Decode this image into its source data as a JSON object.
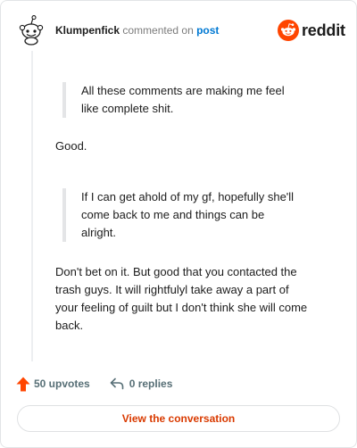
{
  "header": {
    "username": "Klumpenfick",
    "action_text": "commented on",
    "post_link": "post",
    "brand": "reddit"
  },
  "comment": {
    "quote_1_lines": [
      "All these comments are making me feel",
      "like complete shit."
    ],
    "reply_1": "Good.",
    "quote_2_lines": [
      "If I can get ahold of my gf, hopefully she'll",
      "come back to me and things can be",
      "alright."
    ],
    "reply_2_lines": [
      "Don't bet on it. But good that you contacted the",
      "trash guys. It will rightfulyl take away a part of",
      "your feeling of guilt but I don't think she will come",
      "back."
    ]
  },
  "footer": {
    "upvotes": "50 upvotes",
    "replies": "0 replies",
    "cta_label": "View the conversation"
  },
  "colors": {
    "brand_orange": "#ff4500",
    "upvote_orange": "#ff4500",
    "link_blue": "#0079d3",
    "cta_text": "#d93a00"
  }
}
